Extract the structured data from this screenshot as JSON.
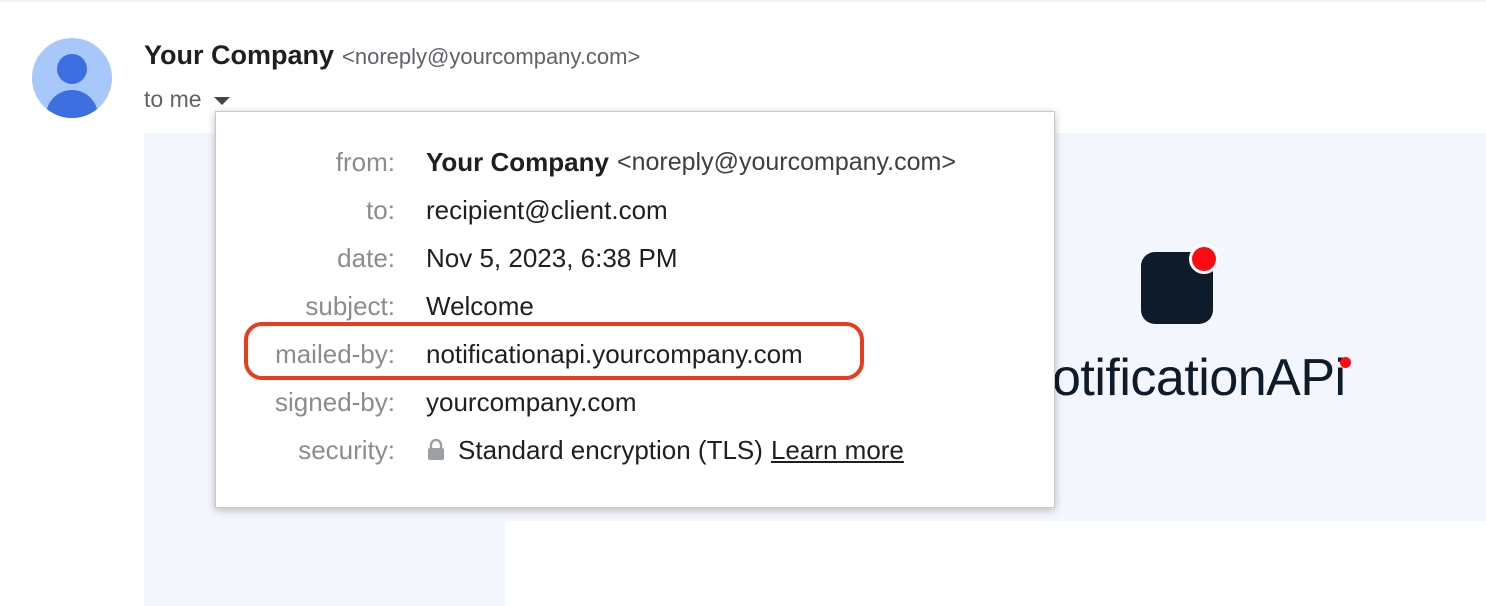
{
  "email": {
    "sender_name": "Your Company",
    "sender_email": "<noreply@yourcompany.com>",
    "to_label": "to me"
  },
  "details": {
    "rows": [
      {
        "label": "from:",
        "name": "Your Company",
        "value": "<noreply@yourcompany.com>"
      },
      {
        "label": "to:",
        "value": "recipient@client.com"
      },
      {
        "label": "date:",
        "value": "Nov 5, 2023, 6:38 PM"
      },
      {
        "label": "subject:",
        "value": "Welcome"
      },
      {
        "label": "mailed-by:",
        "value": "notificationapi.yourcompany.com"
      },
      {
        "label": "signed-by:",
        "value": "yourcompany.com"
      },
      {
        "label": "security:",
        "value": "Standard encryption (TLS)",
        "link": "Learn more",
        "icon": "lock-icon"
      }
    ]
  },
  "brand": {
    "wordmark": "otificationAPi",
    "accent_color": "#ff0a12",
    "dark_color": "#0e1b2a"
  },
  "highlight": {
    "color": "#ea3a1f",
    "target": "mailed-by"
  }
}
